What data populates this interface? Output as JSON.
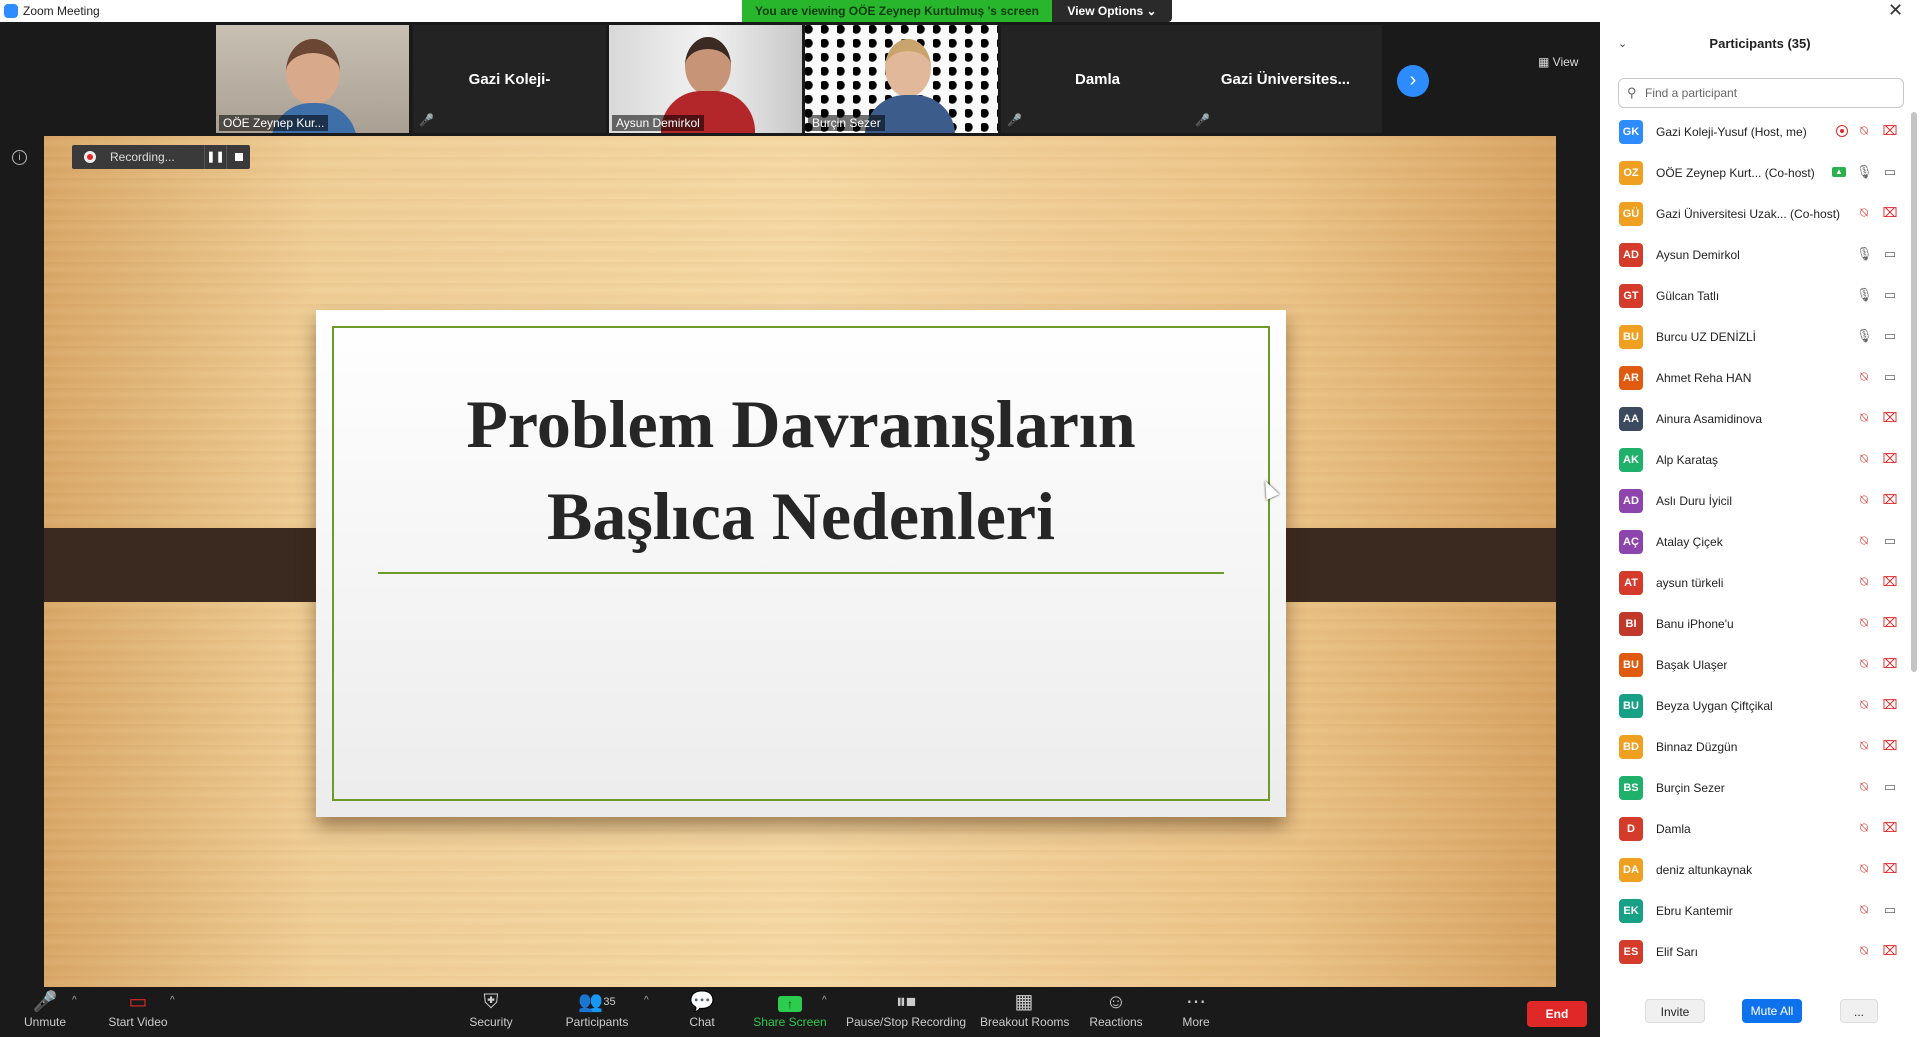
{
  "window": {
    "title": "Zoom Meeting"
  },
  "banner": {
    "viewing": "You are viewing OÖE Zeynep Kurtulmuş 's screen",
    "view_options": "View Options ⌄"
  },
  "gallery": {
    "view_label": "View",
    "tiles": [
      {
        "name": "OÖE Zeynep Kur...",
        "type": "video"
      },
      {
        "name": "Gazi Koleji-",
        "type": "name"
      },
      {
        "name": "Aysun Demirkol",
        "type": "video"
      },
      {
        "name": "Burçin Sezer",
        "type": "video"
      },
      {
        "name": "Damla",
        "type": "name"
      },
      {
        "name": "Gazi  Üniversites...",
        "type": "name"
      }
    ]
  },
  "recording": {
    "label": "Recording...",
    "pause": "❚❚"
  },
  "slide": {
    "title_line1": "Problem Davranışların",
    "title_line2": "Başlıca Nedenleri"
  },
  "toolbar": {
    "unmute": "Unmute",
    "start_video": "Start Video",
    "security": "Security",
    "participants": "Participants",
    "participants_count": "35",
    "chat": "Chat",
    "share_screen": "Share Screen",
    "pause_recording": "Pause/Stop Recording",
    "breakout": "Breakout Rooms",
    "reactions": "Reactions",
    "more": "More",
    "end": "End"
  },
  "panel": {
    "title": "Participants (35)",
    "search_placeholder": "Find a participant",
    "invite": "Invite",
    "mute_all": "Mute All",
    "more": "...",
    "participants": [
      {
        "initials": "GK",
        "name": "Gazi Koleji-Yusuf (Host, me)",
        "color": "#2d8cff",
        "mic": "off",
        "cam": "off",
        "rec": true
      },
      {
        "initials": "OZ",
        "name": "OÖE Zeynep Kurt...  (Co-host)",
        "color": "#f0a020",
        "mic": "on",
        "cam": "on",
        "share": true
      },
      {
        "initials": "GÜ",
        "name": "Gazi Üniversitesi Uzak... (Co-host)",
        "color": "#f0a020",
        "mic": "off",
        "cam": "off"
      },
      {
        "initials": "AD",
        "name": "Aysun Demirkol",
        "color": "#d43b2a",
        "mic": "on",
        "cam": "on"
      },
      {
        "initials": "GT",
        "name": "Gülcan Tatlı",
        "color": "#d43b2a",
        "mic": "on",
        "cam": "on"
      },
      {
        "initials": "BU",
        "name": "Burcu UZ DENİZLİ",
        "color": "#f0a020",
        "mic": "on",
        "cam": "on"
      },
      {
        "initials": "AR",
        "name": "Ahmet Reha HAN",
        "color": "#e05a10",
        "mic": "off",
        "cam": "on"
      },
      {
        "initials": "AA",
        "name": "Ainura Asamidinova",
        "color": "#3b4a5e",
        "mic": "off",
        "cam": "off"
      },
      {
        "initials": "AK",
        "name": "Alp Karataş",
        "color": "#1fb06a",
        "mic": "off",
        "cam": "off"
      },
      {
        "initials": "AD",
        "name": "Aslı Duru İyicil",
        "color": "#8e44ad",
        "mic": "off",
        "cam": "off"
      },
      {
        "initials": "AÇ",
        "name": "Atalay Çiçek",
        "color": "#8e44ad",
        "mic": "off",
        "cam": "on"
      },
      {
        "initials": "AT",
        "name": "aysun türkeli",
        "color": "#d43b2a",
        "mic": "off",
        "cam": "off"
      },
      {
        "initials": "BI",
        "name": "Banu iPhone'u",
        "color": "#c0392b",
        "mic": "off",
        "cam": "off"
      },
      {
        "initials": "BU",
        "name": "Başak Ulaşer",
        "color": "#e05a10",
        "mic": "off",
        "cam": "off"
      },
      {
        "initials": "BU",
        "name": "Beyza Uygan Çiftçikal",
        "color": "#16a085",
        "mic": "off",
        "cam": "off"
      },
      {
        "initials": "BD",
        "name": "Binnaz Düzgün",
        "color": "#f0a020",
        "mic": "off",
        "cam": "off"
      },
      {
        "initials": "BS",
        "name": "Burçin Sezer",
        "color": "#1fb06a",
        "mic": "off",
        "cam": "on"
      },
      {
        "initials": "D",
        "name": "Damla",
        "color": "#d43b2a",
        "mic": "off",
        "cam": "off"
      },
      {
        "initials": "DA",
        "name": "deniz altunkaynak",
        "color": "#f0a020",
        "mic": "off",
        "cam": "off"
      },
      {
        "initials": "EK",
        "name": "Ebru Kantemir",
        "color": "#16a085",
        "mic": "off",
        "cam": "on"
      },
      {
        "initials": "ES",
        "name": "Elif Sarı",
        "color": "#d43b2a",
        "mic": "off",
        "cam": "off"
      }
    ]
  }
}
